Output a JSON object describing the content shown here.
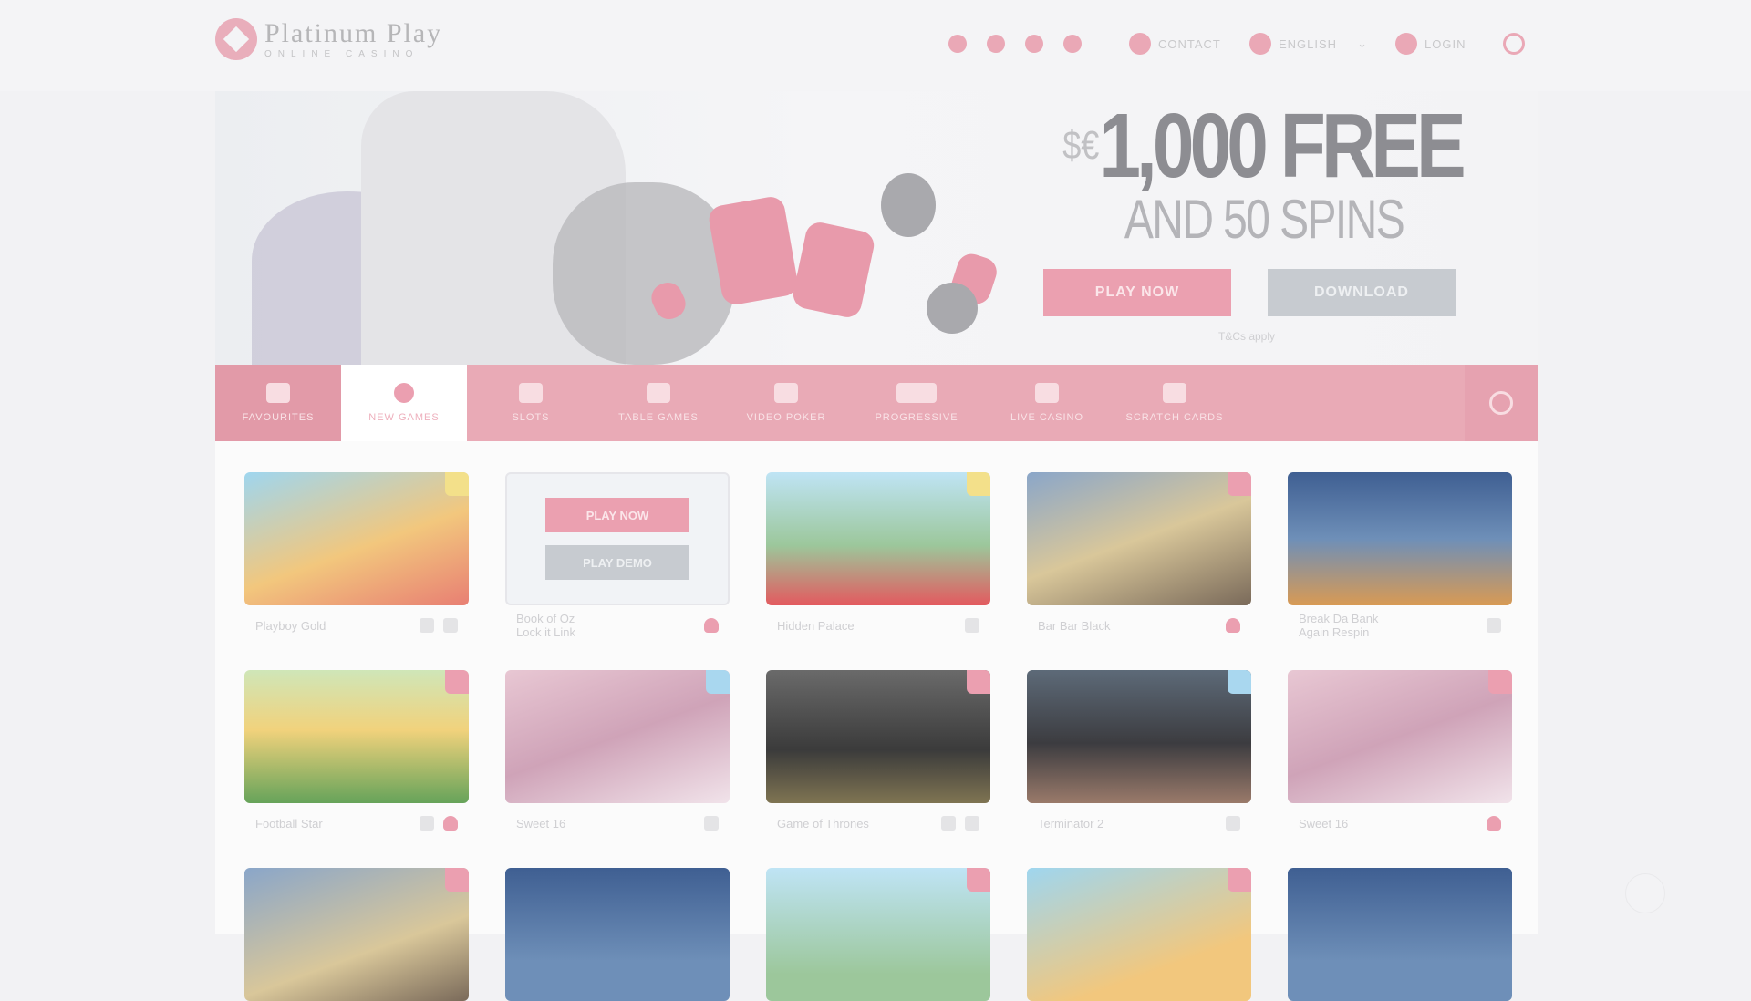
{
  "brand": {
    "name": "Platinum Play",
    "tagline": "ONLINE CASINO"
  },
  "header": {
    "contact": "CONTACT",
    "language": "ENGLISH",
    "login": "LOGIN"
  },
  "banner": {
    "currency": "$€",
    "amount": "1,000 FREE",
    "subline": "AND 50 SPINS",
    "play_now": "PLAY NOW",
    "download": "DOWNLOAD",
    "terms": "T&Cs apply"
  },
  "categories": [
    {
      "label": "FAVOURITES",
      "icon": "heart-icon"
    },
    {
      "label": "NEW GAMES",
      "icon": "star-icon"
    },
    {
      "label": "SLOTS",
      "icon": "slot-icon"
    },
    {
      "label": "TABLE GAMES",
      "icon": "chip-icon"
    },
    {
      "label": "VIDEO POKER",
      "icon": "cards-icon"
    },
    {
      "label": "PROGRESSIVE",
      "icon": "money-icon"
    },
    {
      "label": "LIVE CASINO",
      "icon": "horseshoe-icon"
    },
    {
      "label": "SCRATCH CARDS",
      "icon": "pen-icon"
    }
  ],
  "games": [
    {
      "title": "Playboy Gold",
      "lines": [],
      "demo": false
    },
    {
      "title": "Book of Oz",
      "lines": [
        "Book of Oz",
        "Lock it Link"
      ],
      "demo": true,
      "play_now": "PLAY NOW",
      "demo_label": "PLAY DEMO"
    },
    {
      "title": "Hidden Palace",
      "lines": [],
      "demo": false
    },
    {
      "title": "Bar Bar Black",
      "lines": [],
      "demo": false
    },
    {
      "title": "Break Da Bank",
      "lines": [
        "Break Da Bank",
        "Again Respin"
      ],
      "demo": false
    },
    {
      "title": "Football Star",
      "lines": [],
      "demo": false
    },
    {
      "title": "Sweet 16",
      "lines": [],
      "demo": false
    },
    {
      "title": "Game of Thrones",
      "lines": [],
      "demo": false
    },
    {
      "title": "Terminator 2",
      "lines": [],
      "demo": false
    },
    {
      "title": "Sweet 16",
      "lines": [],
      "demo": false
    }
  ],
  "colors": {
    "accent": "#e9aab6",
    "accent_strong": "#eb9fb0",
    "neutral_button": "#c7cbd0",
    "background": "#f2f2f4"
  }
}
